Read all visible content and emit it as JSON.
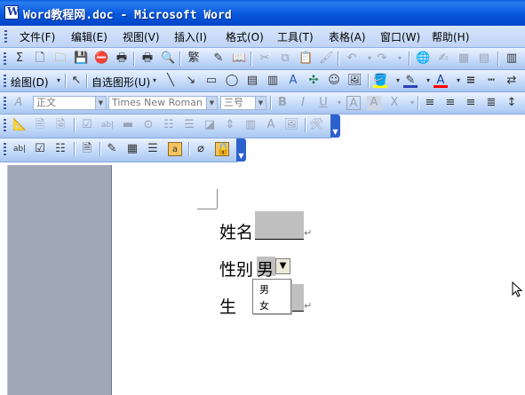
{
  "window": {
    "title": "Word教程网.doc - Microsoft Word"
  },
  "menubar": {
    "items": [
      "文件(F)",
      "编辑(E)",
      "视图(V)",
      "插入(I)",
      "格式(O)",
      "工具(T)",
      "表格(A)",
      "窗口(W)",
      "帮助(H)"
    ]
  },
  "drawing_toolbar": {
    "draw_label": "绘图(D)",
    "autoshape_label": "自选图形(U)"
  },
  "format_toolbar": {
    "style": "正文",
    "font": "Times New Roman",
    "size": "三号",
    "bold_label": "B",
    "italic_label": "I",
    "underline_label": "U"
  },
  "document": {
    "line1_label": "姓名",
    "line2_label": "性别",
    "line2_value": "男",
    "line3_label": "生",
    "dropdown_options": [
      "男",
      "女"
    ]
  },
  "colors": {
    "titlebar": "#0858dc",
    "toolbar": "#c3d9f9",
    "highlight": "#ffff00",
    "font_color": "#ff0000",
    "gray_margin": "#a0a8b8"
  }
}
